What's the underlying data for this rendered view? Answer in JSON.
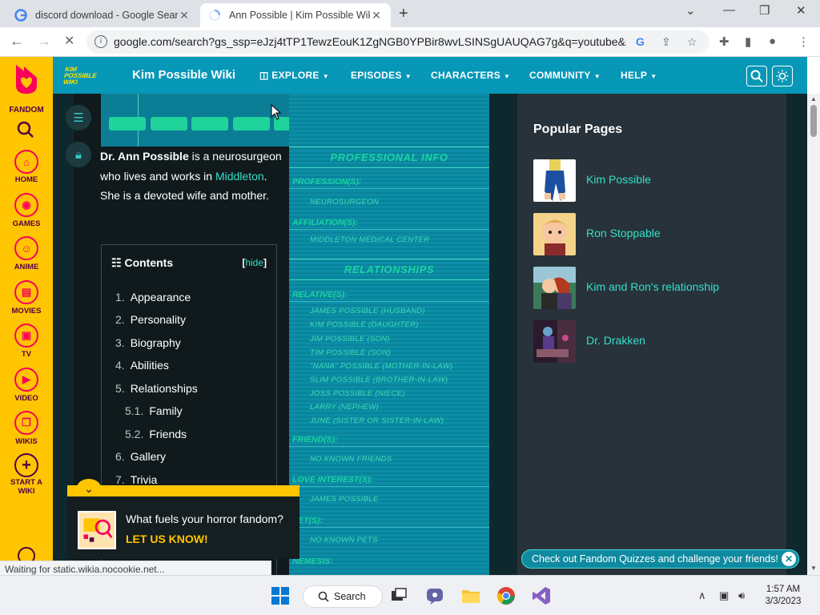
{
  "browser": {
    "tabs": [
      {
        "title": "discord download - Google Search",
        "close": "✕"
      },
      {
        "title": "Ann Possible | Kim Possible Wiki |",
        "close": "✕"
      }
    ],
    "new_tab": "+",
    "url": "google.com/search?gs_ssp=eJzj4tTP1TewzEouK1ZgNGB0YPBir8wvLSINSgUAUQAG7g&q=youtube&rlz...",
    "status": "Waiting for static.wikia.nocookie.net..."
  },
  "rail": {
    "brand": "FANDOM",
    "items": [
      {
        "label": "HOME",
        "icon": "⌂"
      },
      {
        "label": "GAMES",
        "icon": "◉"
      },
      {
        "label": "ANIME",
        "icon": "☺"
      },
      {
        "label": "MOVIES",
        "icon": "▤"
      },
      {
        "label": "TV",
        "icon": "▣"
      },
      {
        "label": "VIDEO",
        "icon": "▶"
      },
      {
        "label": "WIKIS",
        "icon": "❐"
      },
      {
        "label": "START A\nWIKI",
        "icon": "+"
      }
    ]
  },
  "header": {
    "logo_text": "KIM POSSIBLE WIKI",
    "wiki_name": "Kim Possible Wiki",
    "menus": [
      "EXPLORE",
      "EPISODES",
      "CHARACTERS",
      "COMMUNITY",
      "HELP"
    ]
  },
  "article": {
    "intro_bold": "Dr. Ann Possible",
    "intro_1": " is a neurosurgeon who lives and works in ",
    "intro_link": "Middleton",
    "intro_2": ". She is a devoted wife and mother.",
    "toc": {
      "title": "Contents",
      "hide_open": "[",
      "hide": "hide",
      "hide_close": "]",
      "items": [
        {
          "num": "1.",
          "label": "Appearance"
        },
        {
          "num": "2.",
          "label": "Personality"
        },
        {
          "num": "3.",
          "label": "Biography"
        },
        {
          "num": "4.",
          "label": "Abilities"
        },
        {
          "num": "5.",
          "label": "Relationships"
        },
        {
          "num": "5.1.",
          "label": "Family"
        },
        {
          "num": "5.2.",
          "label": "Friends"
        },
        {
          "num": "6.",
          "label": "Gallery"
        },
        {
          "num": "7.",
          "label": "Trivia"
        }
      ]
    }
  },
  "infobox": {
    "professional_header": "PROFESSIONAL INFO",
    "profession_label": "PROFESSION(S):",
    "profession": "NEUROSURGEON",
    "affiliation_label": "AFFILIATION(S):",
    "affiliation": "MIDDLETON MEDICAL CENTER",
    "relationships_header": "RELATIONSHIPS",
    "relatives_label": "RELATIVE(S):",
    "relatives": [
      "JAMES POSSIBLE (HUSBAND)",
      "KIM POSSIBLE (DAUGHTER)",
      "JIM POSSIBLE (SON)",
      "TIM POSSIBLE (SON)",
      "\"NANA\" POSSIBLE (MOTHER-IN-LAW)",
      "SLIM POSSIBLE (BROTHER-IN-LAW)",
      "JOSS POSSIBLE (NIECE)",
      "LARRY (NEPHEW)",
      "JUNE (SISTER OR SISTER-IN-LAW)"
    ],
    "friends_label": "FRIEND(S):",
    "friends": "NO KNOWN FRIENDS",
    "love_label": "LOVE INTEREST(S):",
    "love": "JAMES POSSIBLE",
    "pets_label": "PET(S):",
    "pets": "NO KNOWN PETS",
    "nemesis_label": "NEMESIS:"
  },
  "popular": {
    "title": "Popular Pages",
    "items": [
      {
        "label": "Kim Possible"
      },
      {
        "label": "Ron Stoppable"
      },
      {
        "label": "Kim and Ron's relationship"
      },
      {
        "label": "Dr. Drakken"
      }
    ]
  },
  "promo": {
    "question": "What fuels your horror fandom?",
    "cta": "LET US KNOW!"
  },
  "quiz_banner": "Check out Fandom Quizzes and challenge your friends!",
  "taskbar": {
    "search": "Search",
    "time": "1:57 AM",
    "date": "3/3/2023"
  }
}
